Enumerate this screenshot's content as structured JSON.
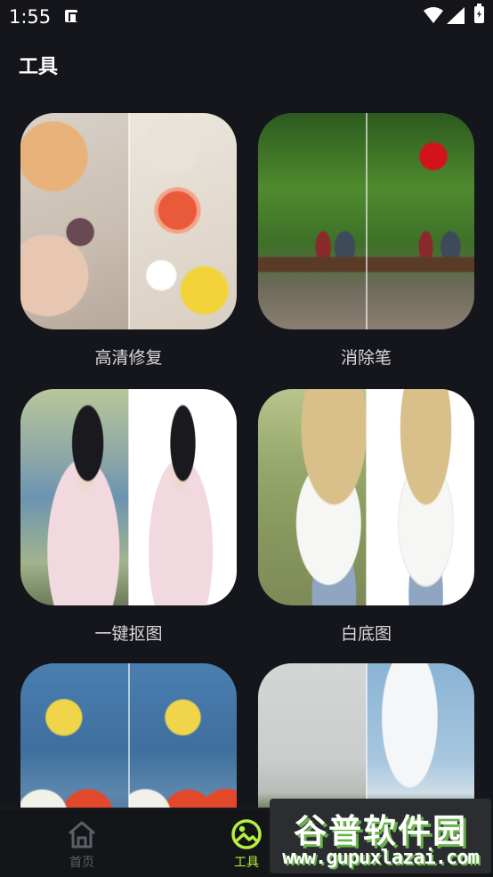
{
  "status_bar": {
    "time": "1:55"
  },
  "header": {
    "title": "工具"
  },
  "tools": [
    {
      "label": "高清修复",
      "thumbnail": "breakfast-table-photo"
    },
    {
      "label": "消除笔",
      "thumbnail": "park-bench-couple-photo"
    },
    {
      "label": "一键抠图",
      "thumbnail": "hanfu-girl-photo"
    },
    {
      "label": "白底图",
      "thumbnail": "straw-hat-girl-photo"
    },
    {
      "label": "",
      "thumbnail": "red-lanterns-photo"
    },
    {
      "label": "",
      "thumbnail": "sky-landscape-photo"
    }
  ],
  "bottom_nav": {
    "items": [
      {
        "label": "首页",
        "icon": "home-icon",
        "active": false
      },
      {
        "label": "工具",
        "icon": "tools-palette-icon",
        "active": true
      }
    ],
    "active_color": "#b6ef3e",
    "inactive_color": "#5d5f66"
  },
  "watermark": {
    "title": "谷普软件园",
    "url": "www.gupuxlazai.com"
  },
  "colors": {
    "background": "#15161b",
    "accent": "#b6ef3e"
  }
}
